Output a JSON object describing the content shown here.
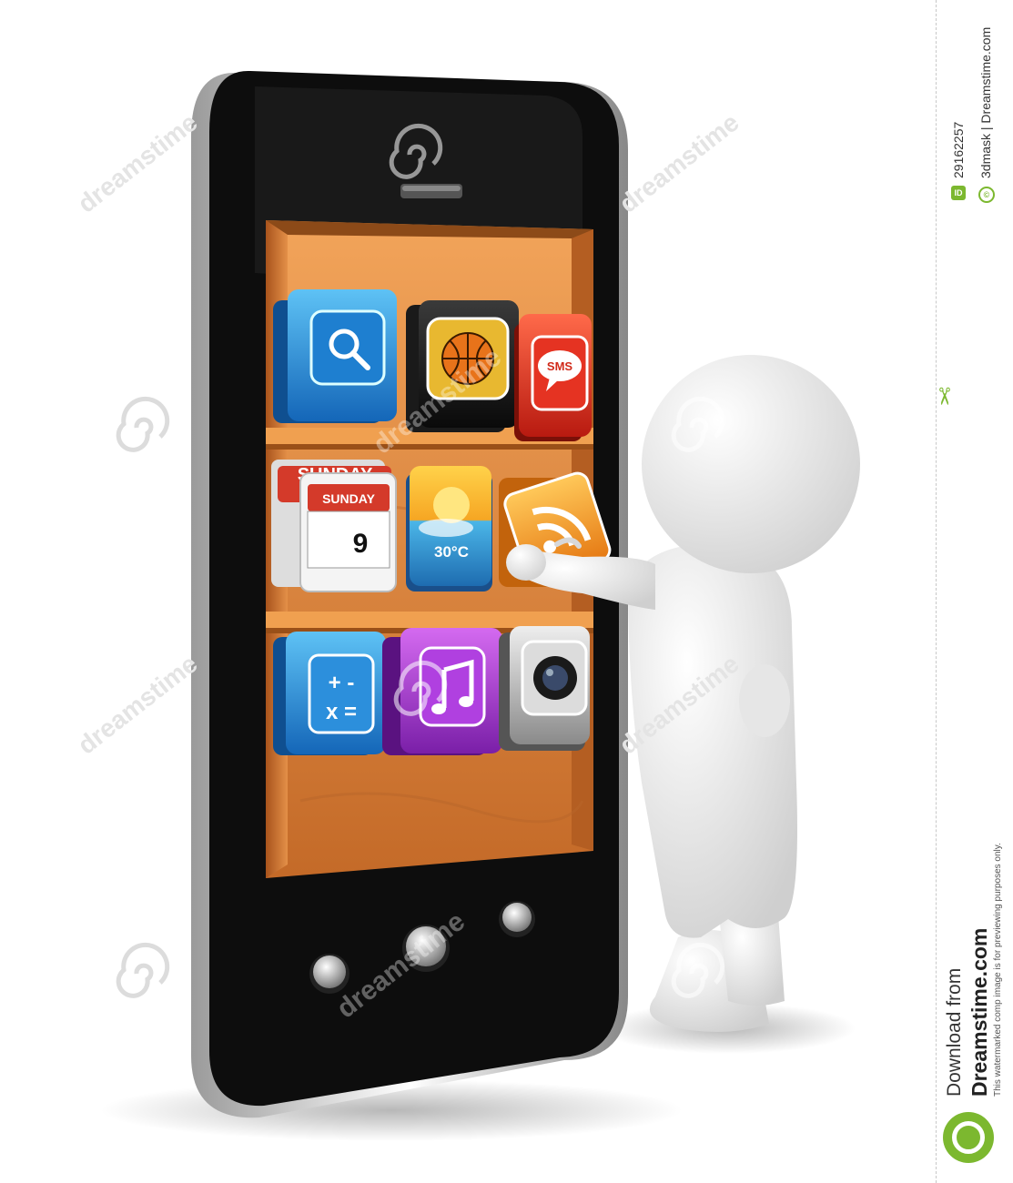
{
  "icons": {
    "search": "magnifier-icon",
    "sport": "basketball-icon",
    "sms": "sms-bubble-icon",
    "calendar": "calendar-icon",
    "weather": "weather-icon",
    "rss": "rss-feed-icon",
    "calculator": "calculator-icon",
    "music": "music-note-icon",
    "camera": "camera-icon"
  },
  "app_text": {
    "sms": "SMS",
    "calendar_day": "SUNDAY",
    "calendar_day_back": "SUNDAY",
    "calendar_date": "9",
    "temperature": "30°C",
    "calc_symbols_top": "+ -",
    "calc_symbols_bottom": "x ="
  },
  "watermark": {
    "brand": "dreamstime",
    "id_badge": "ID",
    "image_id": "29162257",
    "copyright_badge": "©",
    "credit": "3dmask | Dreamstime.com",
    "download_from": "Download from",
    "site": "Dreamstime.com",
    "notice": "This watermarked comp image is for previewing purposes only."
  },
  "colors": {
    "phone_body": "#111111",
    "shelf_wood": "#d9823a",
    "accent_green": "#7cb82f",
    "figure": "#f2f2f2"
  }
}
